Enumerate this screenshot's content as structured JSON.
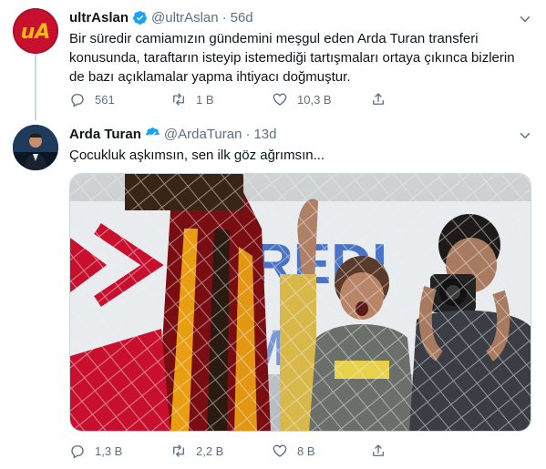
{
  "tweets": [
    {
      "name": "ultrAslan",
      "handle": "@ultrAslan",
      "dot": "·",
      "time": "56d",
      "text": "Bir süredir camiamızın gündemini meşgul eden Arda Turan transferi konusunda, taraftarın isteyip istemediği tartışmaları ortaya çıkınca bizlerin de bazı açıklamalar yapma ihtiyacı doğmuştur.",
      "avatar_text": "uA",
      "replies": "561",
      "retweets": "1 B",
      "likes": "10,3 B"
    },
    {
      "name": "Arda Turan",
      "handle": "@ArdaTuran",
      "dot": "·",
      "time": "13d",
      "text": "Çocukluk aşkımsın, sen ilk göz ağrımsın...",
      "replies": "1,3 B",
      "retweets": "2,2 B",
      "likes": "8 B"
    }
  ],
  "colors": {
    "accent": "#1da1f2",
    "muted": "#5b7083",
    "galatasaray_red": "#c8102e",
    "galatasaray_yellow": "#fdb913"
  },
  "icons": [
    "verified-badge-icon",
    "caret-down-icon",
    "reply-icon",
    "retweet-icon",
    "like-icon",
    "share-icon"
  ]
}
